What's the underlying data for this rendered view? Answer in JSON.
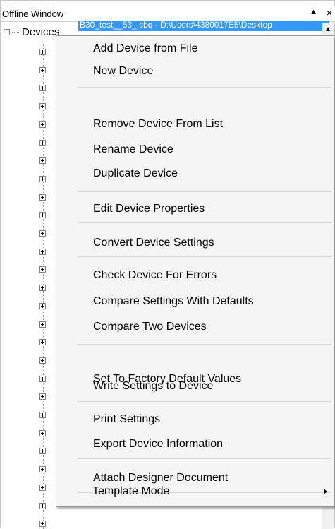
{
  "window": {
    "title": "Offline Window",
    "arrow_glyph": "▲",
    "close_glyph": "×"
  },
  "tree": {
    "root_label": "Devices",
    "selected_item_text": "B30_test__53_.cbq - D:\\Users\\4380017E5\\Desktop"
  },
  "context_menu": {
    "items": [
      {
        "label": "Add Device from File"
      },
      {
        "label": "New Device"
      },
      {
        "label": "Remove Device From List"
      },
      {
        "label": "Rename Device"
      },
      {
        "label": "Duplicate Device"
      },
      {
        "label": "Edit Device Properties"
      },
      {
        "label": "Convert Device Settings"
      },
      {
        "label": "Check Device For Errors"
      },
      {
        "label": "Compare Settings With Defaults"
      },
      {
        "label": "Compare Two Devices"
      },
      {
        "label": "Set To Factory Default Values"
      },
      {
        "label": "Write Settings to Device"
      },
      {
        "label": "Print Settings"
      },
      {
        "label": "Export Device Information"
      },
      {
        "label": "Attach Designer Document"
      },
      {
        "label": "Template Mode",
        "has_submenu": true
      }
    ]
  }
}
